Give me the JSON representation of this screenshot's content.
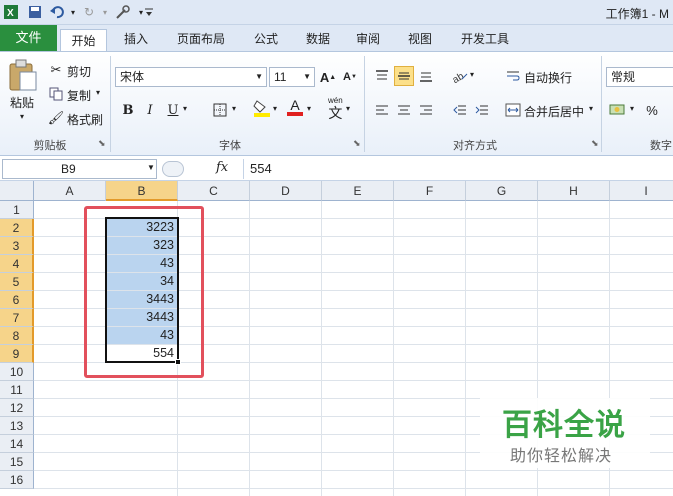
{
  "window": {
    "title": "工作簿1 - M"
  },
  "quick_access": {
    "excel_icon": "excel-logo-icon",
    "save": "save-icon",
    "undo": "undo-icon",
    "redo": "redo-icon",
    "customize": "customize-icon"
  },
  "tabs": [
    "文件",
    "开始",
    "插入",
    "页面布局",
    "公式",
    "数据",
    "审阅",
    "视图",
    "开发工具"
  ],
  "clipboard": {
    "paste": "粘贴",
    "cut": "剪切",
    "copy": "复制",
    "format_painter": "格式刷",
    "label": "剪贴板"
  },
  "font": {
    "name": "宋体",
    "size": "11",
    "label": "字体",
    "grow": "A",
    "shrink": "A",
    "bold": "B",
    "italic": "I",
    "underline": "U",
    "color_glyph": "A",
    "wen": "wén",
    "wen_char": "文"
  },
  "alignment": {
    "wrap": "自动换行",
    "merge": "合并后居中",
    "label": "对齐方式"
  },
  "number": {
    "format": "常规",
    "percent": "%",
    "label": "数字"
  },
  "formula_bar": {
    "cell_ref": "B9",
    "fx": "fx",
    "value": "554"
  },
  "columns": [
    "A",
    "B",
    "C",
    "D",
    "E",
    "F",
    "G",
    "H",
    "I"
  ],
  "rows": [
    "1",
    "2",
    "3",
    "4",
    "5",
    "6",
    "7",
    "8",
    "9",
    "10",
    "11",
    "12",
    "13",
    "14",
    "15",
    "16"
  ],
  "cells_b": [
    "",
    "3223",
    "323",
    "43",
    "34",
    "3443",
    "3443",
    "43",
    "554"
  ],
  "watermark": {
    "title": "百科全说",
    "subtitle": "助你轻松解决"
  },
  "colors": {
    "file_tab": "#2a8f3e",
    "selection_fill": "#bad4ef",
    "highlight_box": "#e2505c",
    "active_header": "#f6d48a"
  }
}
